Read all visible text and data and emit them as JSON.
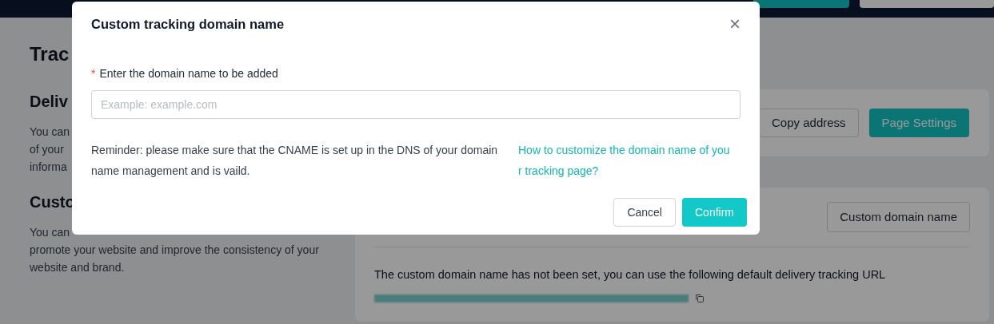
{
  "page": {
    "title": "Trac",
    "sections": [
      {
        "heading": "Deliv",
        "lines": [
          "You can",
          "of your",
          "informa"
        ]
      },
      {
        "heading": "Custo",
        "lines": [
          "You can",
          "promote your website and improve the consistency of your",
          "website and brand."
        ]
      }
    ],
    "delivery_card": {
      "buttons": [
        "Copy address",
        "Page Settings"
      ]
    },
    "domain_card": {
      "button": "Custom domain name",
      "message": "The custom domain name has not been set, you can use the following default delivery tracking URL"
    }
  },
  "dialog": {
    "title": "Custom tracking domain name",
    "close": "×",
    "field": {
      "required_mark": "*",
      "label": "Enter the domain name to be added",
      "placeholder": "Example: example.com"
    },
    "reminder": "Reminder: please make sure that the CNAME is set up in the DNS of your domain name management and is vaild.",
    "help_link": "How to customize the domain name of your tracking page?",
    "buttons": [
      {
        "label": "Cancel",
        "kind": "secondary"
      },
      {
        "label": "Confirm",
        "kind": "primary"
      }
    ]
  }
}
